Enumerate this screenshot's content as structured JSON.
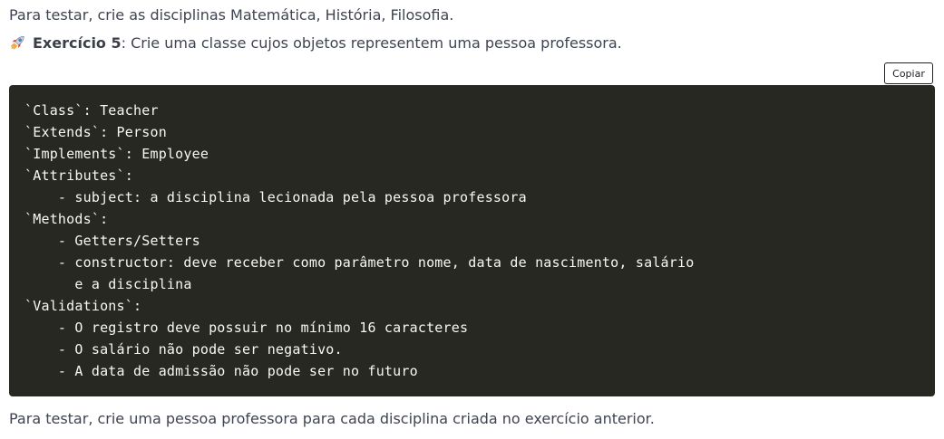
{
  "intro": "Para testar, crie as disciplinas Matemática, História, Filosofia.",
  "exercise": {
    "icon": "rocket-icon",
    "title": "Exercício 5",
    "rest": ": Crie uma classe cujos objetos representem uma pessoa professora."
  },
  "copy_button": {
    "label": "Copiar"
  },
  "code": {
    "lines": [
      "`Class`: Teacher",
      "`Extends`: Person",
      "`Implements`: Employee",
      "`Attributes`:",
      "    - subject: a disciplina lecionada pela pessoa professora",
      "`Methods`:",
      "    - Getters/Setters",
      "    - constructor: deve receber como parâmetro nome, data de nascimento, salário",
      "      e a disciplina",
      "`Validations`:",
      "    - O registro deve possuir no mínimo 16 caracteres",
      "    - O salário não pode ser negativo.",
      "    - A data de admissão não pode ser no futuro"
    ]
  },
  "outro": "Para testar, crie uma pessoa professora para cada disciplina criada no exercício anterior.",
  "colors": {
    "code_background": "#272822",
    "code_text": "#f8f8f2",
    "body_text": "#3e4451"
  }
}
